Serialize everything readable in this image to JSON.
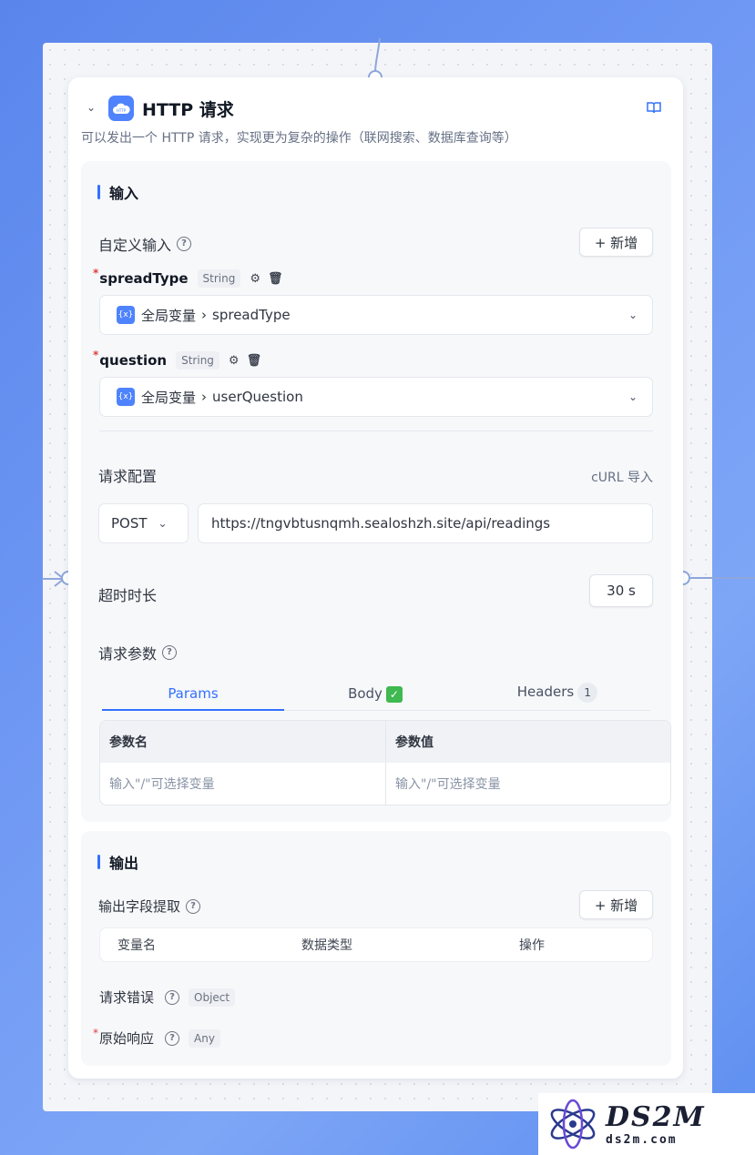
{
  "node": {
    "title": "HTTP 请求",
    "description": "可以发出一个 HTTP 请求，实现更为复杂的操作（联网搜索、数据库查询等）",
    "icon_text": "HTTP"
  },
  "input_section": {
    "title": "输入",
    "custom_input_label": "自定义输入",
    "add_label": "+ 新增",
    "variables": [
      {
        "name": "spreadType",
        "type": "String",
        "source_group": "全局变量",
        "source_value": "spreadType"
      },
      {
        "name": "question",
        "type": "String",
        "source_group": "全局变量",
        "source_value": "userQuestion"
      }
    ],
    "var_icon": "{x}"
  },
  "request_config": {
    "label": "请求配置",
    "curl_import": "cURL 导入",
    "method": "POST",
    "url": "https://tngvbtusnqmh.sealoshzh.site/api/readings"
  },
  "timeout": {
    "label": "超时时长",
    "value": "30 s"
  },
  "params": {
    "label": "请求参数",
    "tabs": [
      {
        "label": "Params",
        "active": true
      },
      {
        "label": "Body",
        "check": "✓"
      },
      {
        "label": "Headers",
        "badge": "1"
      }
    ],
    "table_headers": [
      "参数名",
      "参数值"
    ],
    "placeholders": [
      "输入\"/\"可选择变量",
      "输入\"/\"可选择变量"
    ]
  },
  "output_section": {
    "title": "输出",
    "extract_label": "输出字段提取",
    "add_label": "+ 新增",
    "table_headers": [
      "变量名",
      "数据类型",
      "操作"
    ],
    "rows": [
      {
        "name": "请求错误",
        "type": "Object",
        "required": false
      },
      {
        "name": "原始响应",
        "type": "Any",
        "required": true
      }
    ]
  },
  "watermark": {
    "big": "DS2M",
    "small": "ds2m.com"
  },
  "colors": {
    "accent": "#3370ff",
    "background": "#5a86ec",
    "required": "#e03e3e"
  }
}
